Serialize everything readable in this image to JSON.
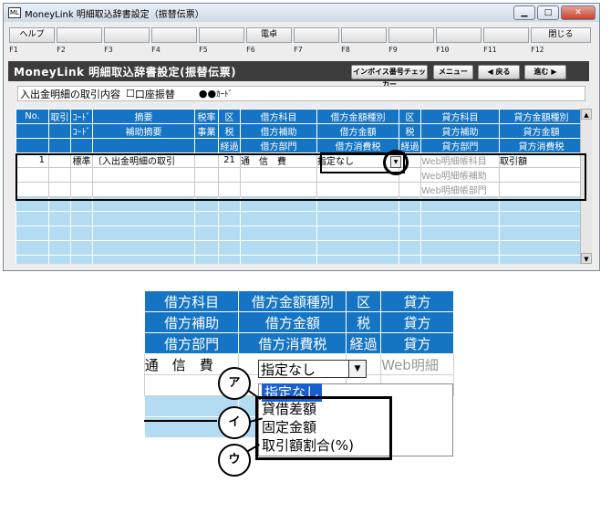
{
  "window": {
    "title": "MoneyLink 明細取込辞書設定（振替伝票）",
    "app_icon": "ML"
  },
  "fkeys": {
    "help": "ヘルプ",
    "calc": "電卓",
    "close": "閉じる",
    "labels": [
      "F1",
      "F2",
      "F3",
      "F4",
      "F5",
      "F6",
      "F7",
      "F8",
      "F9",
      "F10",
      "F11",
      "F12"
    ]
  },
  "header": {
    "title": "MoneyLink 明細取込辞書設定(振替伝票)",
    "invoice_btn": "インボイス番号チェッカー",
    "menu_btn": "メニュー",
    "back_btn": "◀ 戻る",
    "next_btn": "進む ▶"
  },
  "content": {
    "label": "入出金明細の取引内容",
    "checkbox": "☐",
    "transfer": "口座振替",
    "card_prefix": "●●",
    "card": "ｶｰﾄﾞ"
  },
  "grid": {
    "header_rows": [
      [
        "No.",
        "取引",
        "ｺｰﾄﾞ",
        "摘要",
        "税率",
        "区",
        "借方科目",
        "借方金額種別",
        "区",
        "貸方科目",
        "貸方金額種別"
      ],
      [
        "",
        "",
        "ｺｰﾄﾞ",
        "補助摘要",
        "事業",
        "税",
        "借方補助",
        "借方金額",
        "税",
        "貸方補助",
        "貸方金額"
      ],
      [
        "",
        "",
        "",
        "",
        "",
        "経過",
        "借方部門",
        "借方消費税",
        "経過",
        "貸方部門",
        "貸方消費税"
      ]
    ],
    "row": {
      "no": "1",
      "kind": "標準",
      "summary": "〔入出金明細の取引",
      "tax": "21",
      "debit_account": "通　信　費",
      "debit_type": "指定なし",
      "credit_account": "Web明細帳科目",
      "credit_type": "取引額",
      "credit_sub": "Web明細帳補助",
      "credit_dept": "Web明細帳部門"
    }
  },
  "zoom": {
    "header_rows": [
      [
        "借方科目",
        "借方金額種別",
        "区",
        "貸方"
      ],
      [
        "借方補助",
        "借方金額",
        "税",
        "貸方"
      ],
      [
        "借方部門",
        "借方消費税",
        "経過",
        "貸方"
      ]
    ],
    "debit_account": "通　信　費",
    "select_value": "指定なし",
    "credit_preview": "Web明細",
    "options": [
      "指定なし",
      "貸借差額",
      "固定金額",
      "取引額割合(%)"
    ]
  },
  "callouts": [
    "ア",
    "イ",
    "ウ"
  ]
}
